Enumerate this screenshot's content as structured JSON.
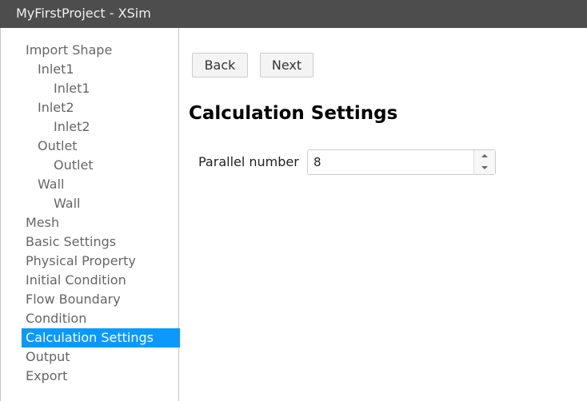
{
  "window": {
    "title": "MyFirstProject - XSim"
  },
  "sidebar": {
    "items": [
      {
        "label": "Import Shape",
        "level": 0,
        "active": false
      },
      {
        "label": "Inlet1",
        "level": 1,
        "active": false
      },
      {
        "label": "Inlet1",
        "level": 2,
        "active": false
      },
      {
        "label": "Inlet2",
        "level": 1,
        "active": false
      },
      {
        "label": "Inlet2",
        "level": 2,
        "active": false
      },
      {
        "label": "Outlet",
        "level": 1,
        "active": false
      },
      {
        "label": "Outlet",
        "level": 2,
        "active": false
      },
      {
        "label": "Wall",
        "level": 1,
        "active": false
      },
      {
        "label": "Wall",
        "level": 2,
        "active": false
      },
      {
        "label": "Mesh",
        "level": 0,
        "active": false
      },
      {
        "label": "Basic Settings",
        "level": 0,
        "active": false
      },
      {
        "label": "Physical Property",
        "level": 0,
        "active": false
      },
      {
        "label": "Initial Condition",
        "level": 0,
        "active": false
      },
      {
        "label": "Flow Boundary",
        "level": 0,
        "active": false
      },
      {
        "label": "Condition",
        "level": 0,
        "active": false
      },
      {
        "label": "Calculation Settings",
        "level": 0,
        "active": true
      },
      {
        "label": "Output",
        "level": 0,
        "active": false
      },
      {
        "label": "Export",
        "level": 0,
        "active": false
      }
    ],
    "active_color": "#0b99ff"
  },
  "toolbar": {
    "back_label": "Back",
    "next_label": "Next"
  },
  "main": {
    "title": "Calculation Settings",
    "fields": {
      "parallel_number": {
        "label": "Parallel number",
        "value": "8"
      }
    }
  }
}
